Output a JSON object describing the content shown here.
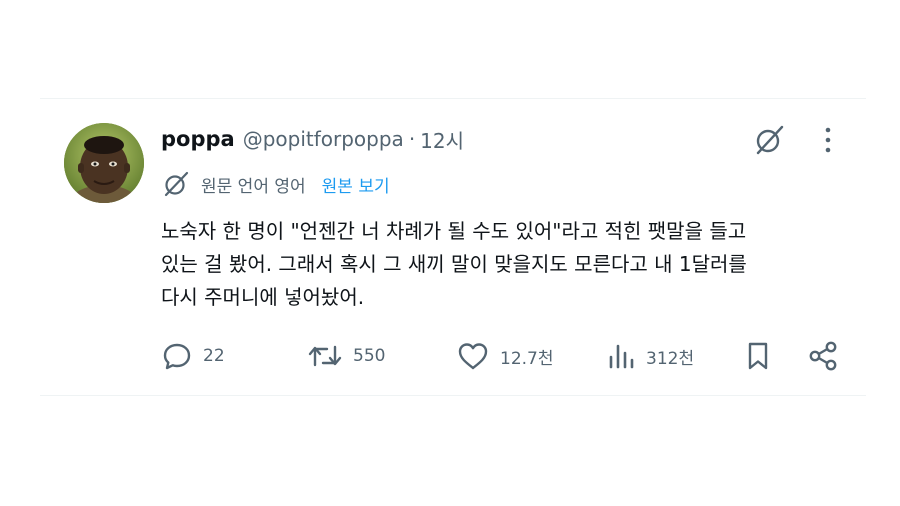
{
  "tweet": {
    "author": {
      "display_name": "poppa",
      "handle": "@popitforpoppa",
      "separator": "·",
      "time": "12시"
    },
    "translation": {
      "label": "원문 언어 영어",
      "link": "원본 보기"
    },
    "body_lines": [
      "노숙자 한 명이 \"언젠간 너 차례가 될 수도 있어\"라고 적힌 팻말을 들고",
      "있는 걸 봤어. 그래서 혹시 그 새끼 말이 맞을지도 모른다고 내 1달러를",
      "다시 주머니에 넣어놨어."
    ],
    "actions": {
      "replies": "22",
      "reposts": "550",
      "likes": "12.7천",
      "views": "312천"
    }
  },
  "icons": {
    "grok": "grok-icon",
    "more": "more-icon",
    "translate": "translate-icon",
    "reply": "reply-icon",
    "repost": "repost-icon",
    "like": "like-icon",
    "views": "views-icon",
    "bookmark": "bookmark-icon",
    "share": "share-icon"
  },
  "colors": {
    "text": "#0f1419",
    "secondary": "#536471",
    "link": "#1d9bf0",
    "divider": "#eff3f4"
  }
}
